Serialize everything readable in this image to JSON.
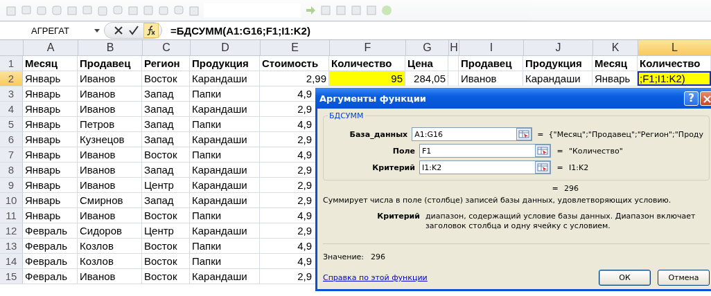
{
  "formula_bar": {
    "name_box": "АГРЕГАТ",
    "formula": "=БДСУММ(A1:G16;F1;I1:K2)"
  },
  "sheet": {
    "columns": [
      {
        "label": "A",
        "selected": false
      },
      {
        "label": "B",
        "selected": false
      },
      {
        "label": "C",
        "selected": false
      },
      {
        "label": "D",
        "selected": false
      },
      {
        "label": "E",
        "selected": false
      },
      {
        "label": "F",
        "selected": false
      },
      {
        "label": "G",
        "selected": false
      },
      {
        "label": "H",
        "selected": false
      },
      {
        "label": "I",
        "selected": false
      },
      {
        "label": "J",
        "selected": false
      },
      {
        "label": "K",
        "selected": false
      },
      {
        "label": "L",
        "selected": true
      }
    ],
    "rows": [
      {
        "number": "1",
        "kind": "header",
        "selected": false,
        "cells": [
          {
            "text": "Месяц"
          },
          {
            "text": "Продавец"
          },
          {
            "text": "Регион"
          },
          {
            "text": "Продукция"
          },
          {
            "text": "Стоимость"
          },
          {
            "text": "Количество"
          },
          {
            "text": "Цена"
          },
          {},
          {
            "text": "Продавец"
          },
          {
            "text": "Продукция"
          },
          {
            "text": "Месяц"
          },
          {
            "text": "Количество"
          }
        ]
      },
      {
        "number": "2",
        "kind": "data",
        "selected": true,
        "cells": [
          {
            "text": "Январь"
          },
          {
            "text": "Иванов"
          },
          {
            "text": "Восток"
          },
          {
            "text": "Карандаши"
          },
          {
            "text": "2,99",
            "kind": "number"
          },
          {
            "text": "95",
            "kind": "number",
            "highlight": true
          },
          {
            "text": "284,05",
            "kind": "number"
          },
          {},
          {
            "text": "Иванов"
          },
          {
            "text": "Карандаши"
          },
          {
            "text": "Январь"
          },
          {
            "text": ";F1;I1:K2)",
            "highlight": true,
            "active": true
          }
        ]
      },
      {
        "number": "3",
        "kind": "data",
        "selected": false,
        "cells": [
          {
            "text": "Январь"
          },
          {
            "text": "Иванов"
          },
          {
            "text": "Запад"
          },
          {
            "text": "Папки"
          },
          {
            "text": "4,9",
            "kind": "number"
          }
        ]
      },
      {
        "number": "4",
        "kind": "data",
        "selected": false,
        "cells": [
          {
            "text": "Январь"
          },
          {
            "text": "Иванов"
          },
          {
            "text": "Запад"
          },
          {
            "text": "Карандаши"
          },
          {
            "text": "2,9",
            "kind": "number"
          }
        ]
      },
      {
        "number": "5",
        "kind": "data",
        "selected": false,
        "cells": [
          {
            "text": "Январь"
          },
          {
            "text": "Петров"
          },
          {
            "text": "Запад"
          },
          {
            "text": "Папки"
          },
          {
            "text": "4,9",
            "kind": "number"
          }
        ]
      },
      {
        "number": "6",
        "kind": "data",
        "selected": false,
        "cells": [
          {
            "text": "Январь"
          },
          {
            "text": "Кузнецов"
          },
          {
            "text": "Запад"
          },
          {
            "text": "Карандаши"
          },
          {
            "text": "2,9",
            "kind": "number"
          }
        ]
      },
      {
        "number": "7",
        "kind": "data",
        "selected": false,
        "cells": [
          {
            "text": "Январь"
          },
          {
            "text": "Иванов"
          },
          {
            "text": "Восток"
          },
          {
            "text": "Папки"
          },
          {
            "text": "4,9",
            "kind": "number"
          }
        ]
      },
      {
        "number": "8",
        "kind": "data",
        "selected": false,
        "cells": [
          {
            "text": "Январь"
          },
          {
            "text": "Иванов"
          },
          {
            "text": "Запад"
          },
          {
            "text": "Карандаши"
          },
          {
            "text": "2,9",
            "kind": "number"
          }
        ]
      },
      {
        "number": "9",
        "kind": "data",
        "selected": false,
        "cells": [
          {
            "text": "Январь"
          },
          {
            "text": "Иванов"
          },
          {
            "text": "Центр"
          },
          {
            "text": "Карандаши"
          },
          {
            "text": "2,9",
            "kind": "number"
          }
        ]
      },
      {
        "number": "10",
        "kind": "data",
        "selected": false,
        "cells": [
          {
            "text": "Январь"
          },
          {
            "text": "Смирнов"
          },
          {
            "text": "Запад"
          },
          {
            "text": "Карандаши"
          },
          {
            "text": "2,9",
            "kind": "number"
          }
        ]
      },
      {
        "number": "11",
        "kind": "data",
        "selected": false,
        "cells": [
          {
            "text": "Январь"
          },
          {
            "text": "Иванов"
          },
          {
            "text": "Восток"
          },
          {
            "text": "Папки"
          },
          {
            "text": "4,9",
            "kind": "number"
          }
        ]
      },
      {
        "number": "12",
        "kind": "data",
        "selected": false,
        "cells": [
          {
            "text": "Февраль"
          },
          {
            "text": "Сидоров"
          },
          {
            "text": "Центр"
          },
          {
            "text": "Карандаши"
          },
          {
            "text": "2,9",
            "kind": "number"
          }
        ]
      },
      {
        "number": "13",
        "kind": "data",
        "selected": false,
        "cells": [
          {
            "text": "Февраль"
          },
          {
            "text": "Козлов"
          },
          {
            "text": "Восток"
          },
          {
            "text": "Папки"
          },
          {
            "text": "4,9",
            "kind": "number"
          }
        ]
      },
      {
        "number": "14",
        "kind": "data",
        "selected": false,
        "cells": [
          {
            "text": "Февраль"
          },
          {
            "text": "Козлов"
          },
          {
            "text": "Восток"
          },
          {
            "text": "Папки"
          },
          {
            "text": "4,9",
            "kind": "number"
          }
        ]
      },
      {
        "number": "15",
        "kind": "data",
        "selected": false,
        "cells": [
          {
            "text": "Февраль"
          },
          {
            "text": "Иванов"
          },
          {
            "text": "Восток"
          },
          {
            "text": "Карандаши"
          },
          {
            "text": "2,9",
            "kind": "number"
          }
        ]
      }
    ]
  },
  "dialog": {
    "title": "Аргументы функции",
    "help_button": "?",
    "close_button": "×",
    "group": "БДСУММ",
    "arguments": [
      {
        "label": "База_данных",
        "value": "A1:G16",
        "equals": "=",
        "result": "{\"Месяц\";\"Продавец\";\"Регион\";\"Проду"
      },
      {
        "label": "Поле",
        "value": "F1",
        "equals": "=",
        "result": "\"Количество\""
      },
      {
        "label": "Критерий",
        "value": "I1:K2",
        "equals": "=",
        "result": "I1:K2"
      }
    ],
    "total_equals": "=",
    "total": "296",
    "description": "Суммирует числа в поле (столбце) записей базы данных, удовлетворяющих условию.",
    "argument_help": {
      "name": "Критерий",
      "text": "диапазон, содержащий условие базы данных. Диапазон включает заголовок столбца и одну ячейку с условием."
    },
    "value_label": "Значение:",
    "value": "296",
    "help_link": "Справка по этой функции",
    "buttons": [
      {
        "label": "ОК",
        "default": true
      },
      {
        "label": "Отмена",
        "default": false
      }
    ]
  }
}
